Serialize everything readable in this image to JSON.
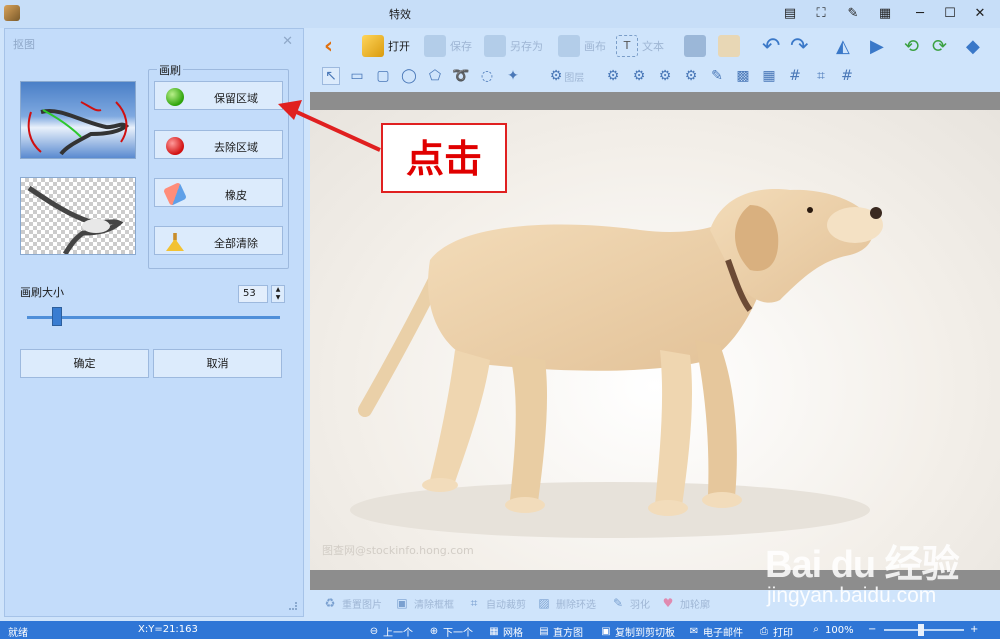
{
  "window": {
    "title": "特效"
  },
  "panel": {
    "header": "抠图",
    "brush_group_label": "画刷",
    "brush_buttons": [
      {
        "label": "保留区域",
        "icon": "green-dot-icon"
      },
      {
        "label": "去除区域",
        "icon": "red-dot-icon"
      },
      {
        "label": "橡皮",
        "icon": "eraser-icon"
      },
      {
        "label": "全部清除",
        "icon": "broom-icon"
      }
    ],
    "brush_size_label": "画刷大小",
    "brush_size_value": "53",
    "brush_size_fraction": 0.12,
    "ok_label": "确定",
    "cancel_label": "取消"
  },
  "toolbar": {
    "open": "打开",
    "save": "保存",
    "save_as": "另存为",
    "canvas": "画布",
    "text": "文本",
    "layer": "图层"
  },
  "annotation": {
    "text": "点击"
  },
  "canvas": {
    "watermark": "图查网@stockinfo.hong.com"
  },
  "bottom_tools": [
    "重置图片",
    "清除框框",
    "自动裁剪",
    "删除环选",
    "羽化",
    "加轮廓"
  ],
  "statusbar": {
    "status": "就绪",
    "coords": "X:Y=21:163",
    "prev": "上一个",
    "next": "下一个",
    "grid": "网格",
    "histogram": "直方图",
    "copy_clipboard": "复制到剪切板",
    "email": "电子邮件",
    "print": "打印",
    "zoom": "100%",
    "zoom_minus": "−",
    "zoom_plus": "+"
  },
  "baidu_watermark": {
    "line1": "Bai du 经验",
    "line2": "jingyan.baidu.com"
  },
  "colors": {
    "accent": "#2f76d6",
    "annotation_red": "#e00000",
    "panel_bg": "#c3dcfa"
  }
}
